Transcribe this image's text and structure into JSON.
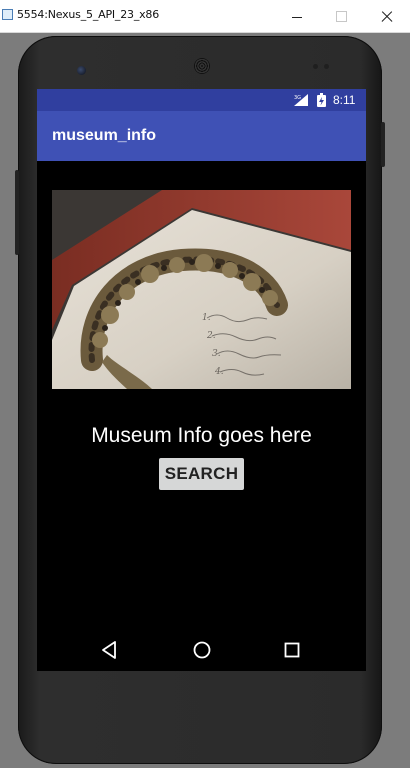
{
  "window": {
    "title": "5554:Nexus_5_API_23_x86",
    "minimize_icon": "minimize-icon",
    "maximize_icon": "maximize-icon",
    "close_icon": "close-icon"
  },
  "status_bar": {
    "network_type": "3G",
    "time": "8:11",
    "color": "#303f9f"
  },
  "app_bar": {
    "title": "museum_info",
    "color": "#3f51b5"
  },
  "content": {
    "image_icon": "museum-artifact-photo",
    "info_text": "Museum Info goes here",
    "search_button_label": "SEARCH"
  },
  "nav_bar": {
    "back_icon": "back-triangle-icon",
    "home_icon": "home-circle-icon",
    "recents_icon": "recents-square-icon"
  }
}
